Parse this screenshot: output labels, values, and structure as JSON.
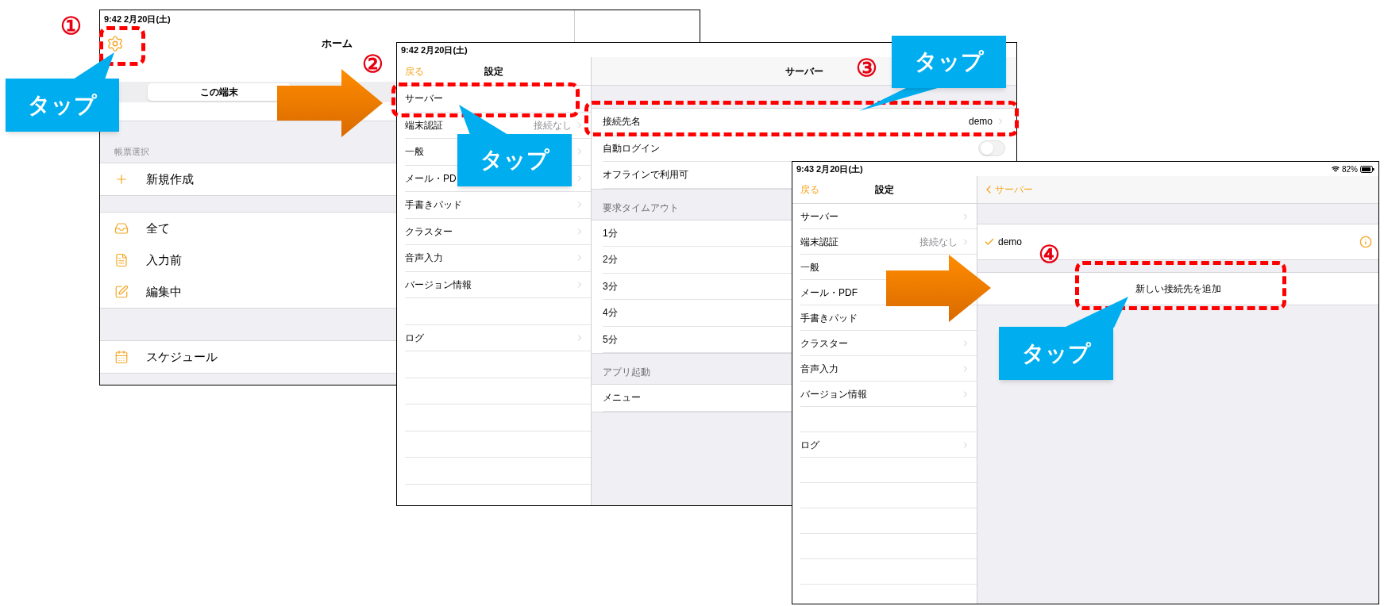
{
  "home_screen": {
    "status_time": "9:42  2月20日(土)",
    "title": "ホーム",
    "segments": [
      {
        "label": "この端末",
        "selected": true
      }
    ],
    "section_header": "帳票選択",
    "groups": [
      [
        {
          "label": "新規作成"
        }
      ],
      [
        {
          "label": "全て"
        },
        {
          "label": "入力前"
        },
        {
          "label": "編集中"
        }
      ],
      [
        {
          "label": "スケジュール"
        }
      ]
    ]
  },
  "settings_screen": {
    "status_time": "9:42  2月20日(土)",
    "back": "戻る",
    "title": "設定",
    "menu_groups": [
      [
        {
          "label": "サーバー",
          "chevron": false
        },
        {
          "label": "端末認証",
          "detail": "接続なし",
          "chevron": true
        },
        {
          "label": "一般",
          "chevron": true
        },
        {
          "label": "メール・PD",
          "chevron": true
        },
        {
          "label": "手書きパッド",
          "chevron": true
        },
        {
          "label": "クラスター",
          "chevron": true
        },
        {
          "label": "音声入力",
          "chevron": true
        },
        {
          "label": "バージョン情報",
          "chevron": true
        }
      ],
      [
        {
          "label": "ログ",
          "chevron": true
        }
      ]
    ],
    "detail": {
      "title": "サーバー",
      "sections": [
        {
          "rows": [
            {
              "kind": "link",
              "label": "接続先名",
              "value": "demo"
            },
            {
              "kind": "toggle",
              "label": "自動ログイン",
              "on": false
            },
            {
              "kind": "plain",
              "label": "オフラインで利用可"
            }
          ]
        },
        {
          "header": "要求タイムアウト",
          "rows": [
            {
              "kind": "plain",
              "label": "1分"
            },
            {
              "kind": "plain",
              "label": "2分"
            },
            {
              "kind": "plain",
              "label": "3分"
            },
            {
              "kind": "plain",
              "label": "4分"
            },
            {
              "kind": "plain",
              "label": "5分"
            }
          ]
        },
        {
          "header": "アプリ起動",
          "rows": [
            {
              "kind": "plain",
              "label": "メニュー"
            }
          ]
        }
      ]
    }
  },
  "server_screen": {
    "status_time": "9:43  2月20日(土)",
    "battery": "82%",
    "back": "戻る",
    "title": "設定",
    "menu_groups": [
      [
        {
          "label": "サーバー",
          "chevron": true
        },
        {
          "label": "端末認証",
          "detail": "接続なし",
          "chevron": true
        },
        {
          "label": "一般",
          "chevron": false
        },
        {
          "label": "メール・PDF",
          "chevron": false
        },
        {
          "label": "手書きパッド",
          "chevron": false
        },
        {
          "label": "クラスター",
          "chevron": true
        },
        {
          "label": "音声入力",
          "chevron": true
        },
        {
          "label": "バージョン情報",
          "chevron": true
        }
      ],
      [
        {
          "label": "ログ",
          "chevron": true
        }
      ]
    ],
    "detail": {
      "back": "サーバー",
      "servers": [
        {
          "name": "demo",
          "selected": true
        }
      ],
      "add_button": "新しい接続先を追加"
    }
  },
  "annotations": {
    "step_markers": [
      "①",
      "②",
      "③",
      "④"
    ],
    "callouts": [
      "タップ",
      "タップ",
      "タップ",
      "タップ"
    ]
  }
}
